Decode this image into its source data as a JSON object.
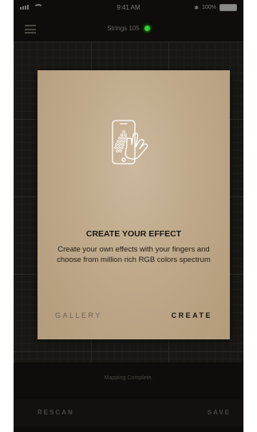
{
  "status_bar": {
    "time": "9:41 AM",
    "battery": "100%"
  },
  "header": {
    "title": "Strings 105",
    "connection_color": "#2ed12e"
  },
  "canvas": {
    "mapping_status": "Mapping Complete."
  },
  "bottom_bar": {
    "rescan_label": "RESCAN",
    "save_label": "SAVE"
  },
  "dialog": {
    "icon": "phone-touch-icon",
    "title": "CREATE YOUR EFFECT",
    "body": "Create your own effects with your fingers and choose from million rich RGB colors spectrum",
    "gallery_label": "GALLERY",
    "create_label": "CREATE"
  },
  "colors": {
    "dialog_background": "#bfaa8c",
    "app_background": "#0e0d0b"
  }
}
